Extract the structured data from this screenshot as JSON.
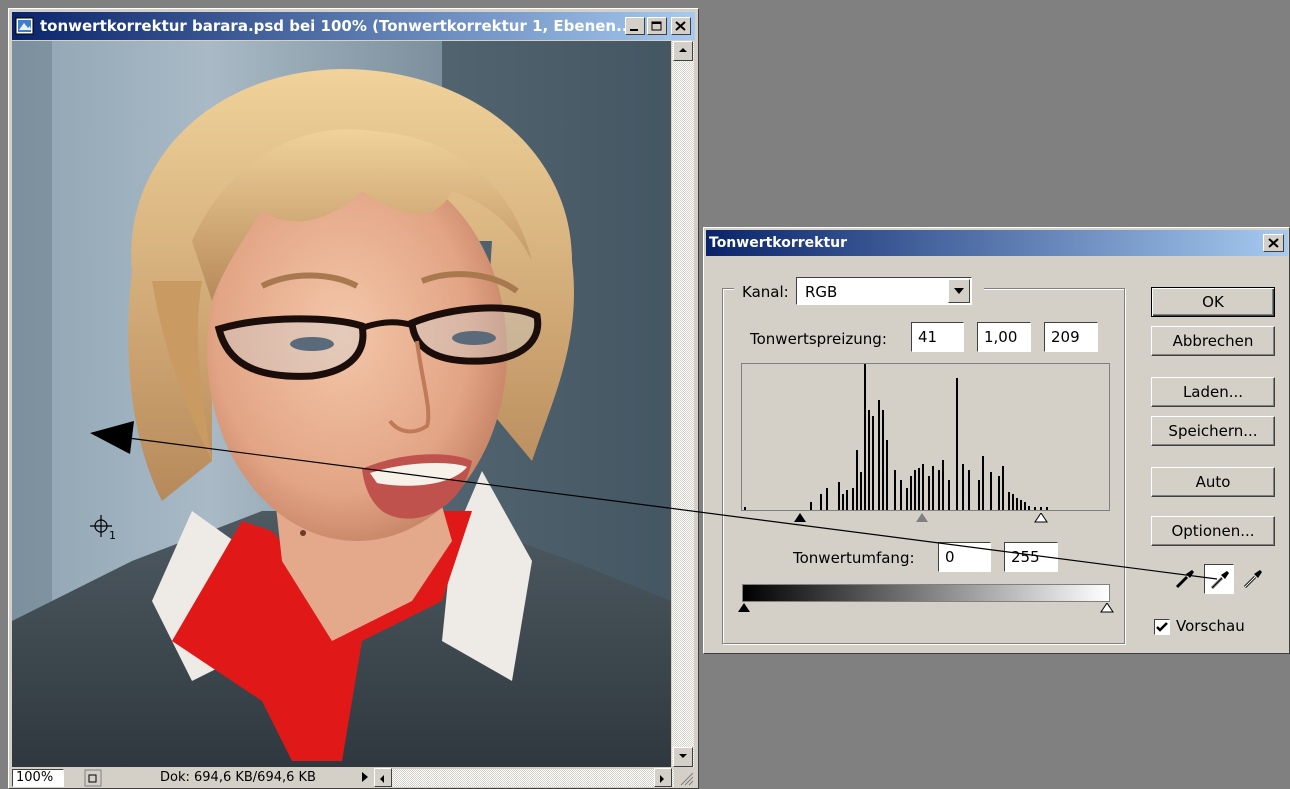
{
  "document": {
    "title": "tonwertkorrektur barara.psd bei 100% (Tonwertkorrektur 1, Ebenen...",
    "zoom": "100%",
    "doc_size": "Dok: 694,6 KB/694,6 KB",
    "sample_marker": "1"
  },
  "dialog": {
    "title": "Tonwertkorrektur",
    "channel_label": "Kanal:",
    "channel_value": "RGB",
    "input_levels_label": "Tonwertspreizung:",
    "input_black": "41",
    "input_gamma": "1,00",
    "input_white": "209",
    "output_levels_label": "Tonwertumfang:",
    "output_black": "0",
    "output_white": "255",
    "buttons": {
      "ok": "OK",
      "cancel": "Abbrechen",
      "load": "Laden...",
      "save": "Speichern...",
      "auto": "Auto",
      "options": "Optionen..."
    },
    "preview_label": "Vorschau",
    "preview_checked": true
  },
  "colors": {
    "titlebar_start": "#0a246a",
    "titlebar_end": "#a6caf0",
    "dialog_face": "#d4d0c8",
    "workspace": "#808080"
  },
  "icons": [
    "photoshop-doc-icon",
    "minimize-icon",
    "maximize-icon",
    "close-icon",
    "scroll-up-icon",
    "scroll-down-icon",
    "scroll-left-icon",
    "scroll-right-icon",
    "dropdown-arrow-icon",
    "black-eyedropper-icon",
    "gray-eyedropper-icon",
    "white-eyedropper-icon",
    "checkmark-icon",
    "color-sampler-icon"
  ]
}
